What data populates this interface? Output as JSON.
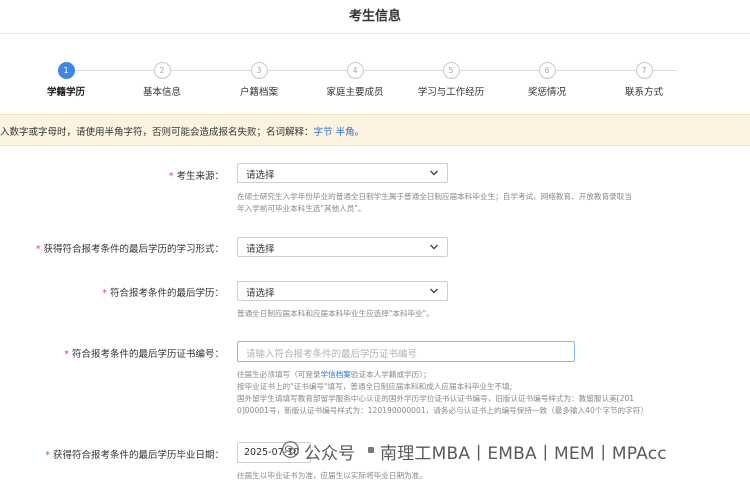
{
  "page": {
    "title": "考生信息"
  },
  "steps": [
    {
      "num": "1",
      "label": "学籍学历",
      "active": true
    },
    {
      "num": "2",
      "label": "基本信息",
      "active": false
    },
    {
      "num": "3",
      "label": "户籍档案",
      "active": false
    },
    {
      "num": "4",
      "label": "家庭主要成员",
      "active": false
    },
    {
      "num": "5",
      "label": "学习与工作经历",
      "active": false
    },
    {
      "num": "6",
      "label": "奖惩情况",
      "active": false
    },
    {
      "num": "7",
      "label": "联系方式",
      "active": false
    }
  ],
  "notice": {
    "text": "入数字或字母时，请使用半角字符，否则可能会造成报名失败；名词解释：",
    "link1": "字节",
    "link2": "半角。"
  },
  "form": {
    "source": {
      "required_mark": "*",
      "label": "考生来源：",
      "value": "请选择",
      "hint_line1": "在硕士研究生入学年份毕业的普通全日制学生属于普通全日制应届本科毕业生；自学考试、网络教育、开放教育录取当",
      "hint_line2": "年入学前可毕业本科生选\"其他人员\"。"
    },
    "study_form": {
      "required_mark": "*",
      "label": "获得符合报考条件的最后学历的学习形式：",
      "value": "请选择"
    },
    "last_degree": {
      "required_mark": "*",
      "label": "符合报考条件的最后学历：",
      "value": "请选择",
      "hint": "普通全日制应届本科和应届本科毕业生应选择\"本科毕业\"。"
    },
    "cert_no": {
      "required_mark": "*",
      "label": "符合报考条件的最后学历证书编号：",
      "placeholder": "请输入符合报考条件的最后学历证书编号",
      "hint_line1_a": "往届生必须填写（可登录",
      "hint_line1_link": "学信档案",
      "hint_line1_b": "验证本人学籍或学历）；",
      "hint_line2": "按毕业证书上的\"证书编号\"填写，普通全日制应届本科和成人应届本科毕业生不填;",
      "hint_line3": "国外留学生请填写教育部留学服务中心认证的国外学历学位证书认证书编号，旧版认证书编号样式为：教留服认美[201",
      "hint_line4": "0]00001号，新版认证书编号样式为：120190000001，请务必与认证书上的编号保持一致（最多输入40个字节的字符）"
    },
    "grad_date": {
      "required_mark": "*",
      "label": "获得符合报考条件的最后学历毕业日期：",
      "value": "2025-07-10",
      "hint": "往届生以毕业证书为准，应届生以实际将毕业日期为准。"
    }
  },
  "watermark": {
    "text": "公众号",
    "name": "南理工MBA丨EMBA丨MEM丨MPAcc",
    "icon": "wechat-icon"
  }
}
